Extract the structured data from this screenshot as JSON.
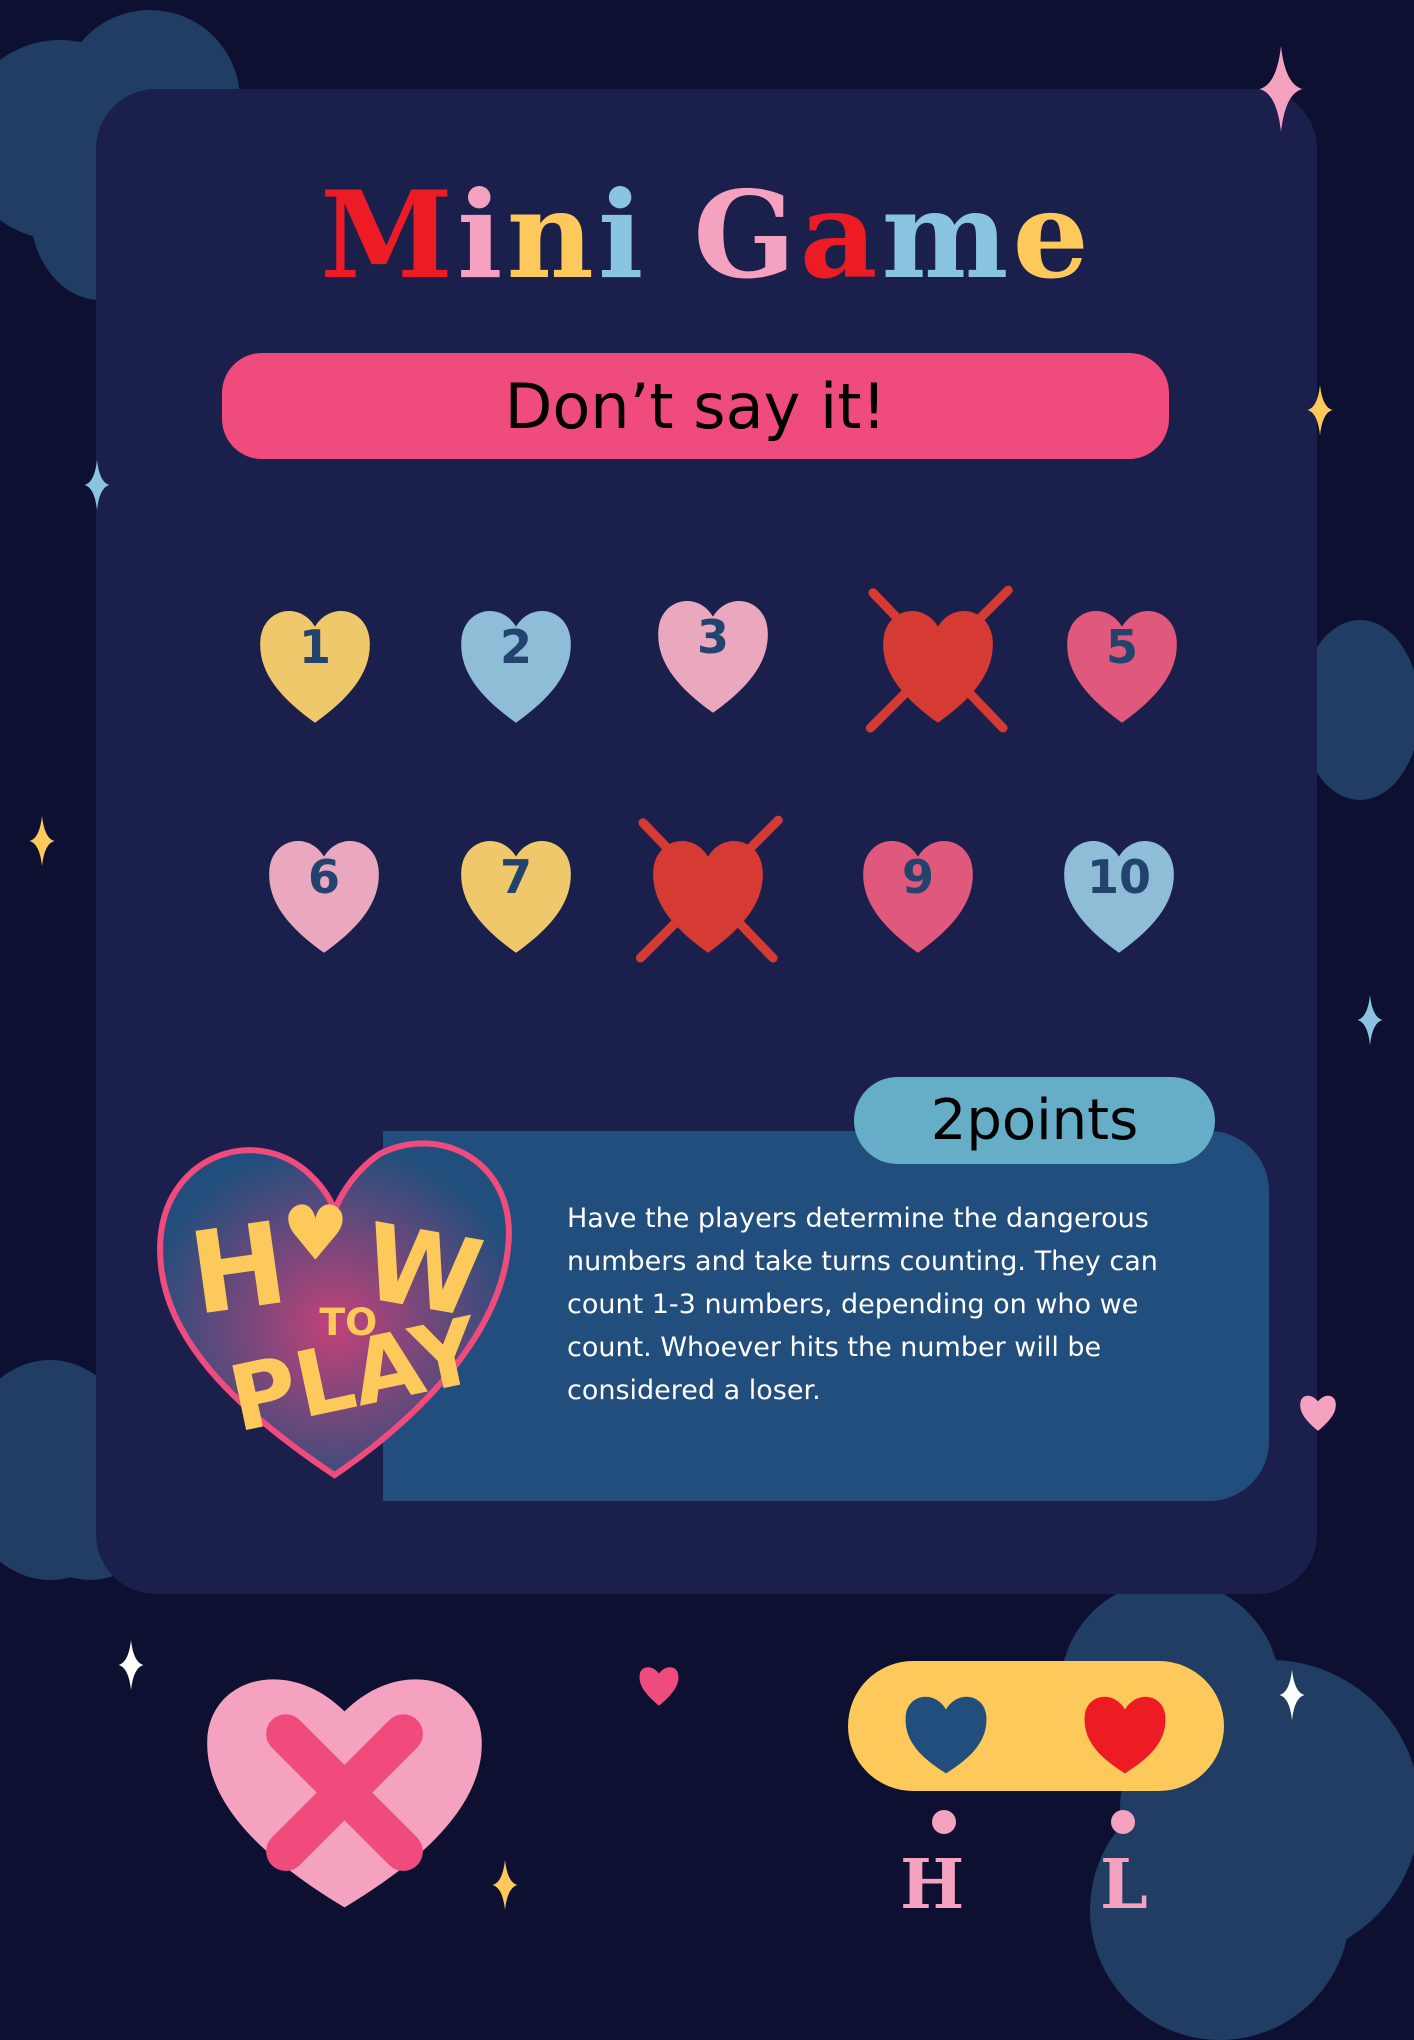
{
  "title": {
    "letters": [
      {
        "ch": "M",
        "color": "#ed1c24"
      },
      {
        "ch": "i",
        "color": "#f5a1c0"
      },
      {
        "ch": "n",
        "color": "#fdc95a"
      },
      {
        "ch": "i",
        "color": "#89c4e1"
      },
      {
        "ch": " ",
        "color": "#fff"
      },
      {
        "ch": "G",
        "color": "#f5a1c0"
      },
      {
        "ch": "a",
        "color": "#ed1c24"
      },
      {
        "ch": "m",
        "color": "#89c4e1"
      },
      {
        "ch": "e",
        "color": "#fdc95a"
      }
    ],
    "text": "Mini Game"
  },
  "subtitle": "Don’t say it!",
  "hearts": [
    {
      "label": "1",
      "color": "#efc86c",
      "crossed": false
    },
    {
      "label": "2",
      "color": "#8fbcd6",
      "crossed": false
    },
    {
      "label": "3",
      "color": "#eaa8be",
      "crossed": false
    },
    {
      "label": "",
      "color": "#d63b33",
      "crossed": true
    },
    {
      "label": "5",
      "color": "#e0587c",
      "crossed": false
    },
    {
      "label": "6",
      "color": "#eaa8be",
      "crossed": false
    },
    {
      "label": "7",
      "color": "#efc86c",
      "crossed": false
    },
    {
      "label": "",
      "color": "#d63b33",
      "crossed": true
    },
    {
      "label": "9",
      "color": "#e0587c",
      "crossed": false
    },
    {
      "label": "10",
      "color": "#8fbcd6",
      "crossed": false
    }
  ],
  "points": "2points",
  "how_to_play": {
    "logo_text": "How to play",
    "description": "Have the players determine the dangerous numbers and take turns counting. They can count 1-3 numbers, depending on who we count. Whoever hits the number will be considered a loser."
  },
  "controls": {
    "close_icon": "x-heart-icon",
    "h_label": "H",
    "l_label": "L",
    "h_heart_color": "#214e7c",
    "l_heart_color": "#ed1c24"
  },
  "colors": {
    "background": "#0d1030",
    "card": "#1b1f4b",
    "accent_pink": "#ef4b7d",
    "accent_yellow": "#fdc95a",
    "accent_blue": "#66adc8"
  }
}
